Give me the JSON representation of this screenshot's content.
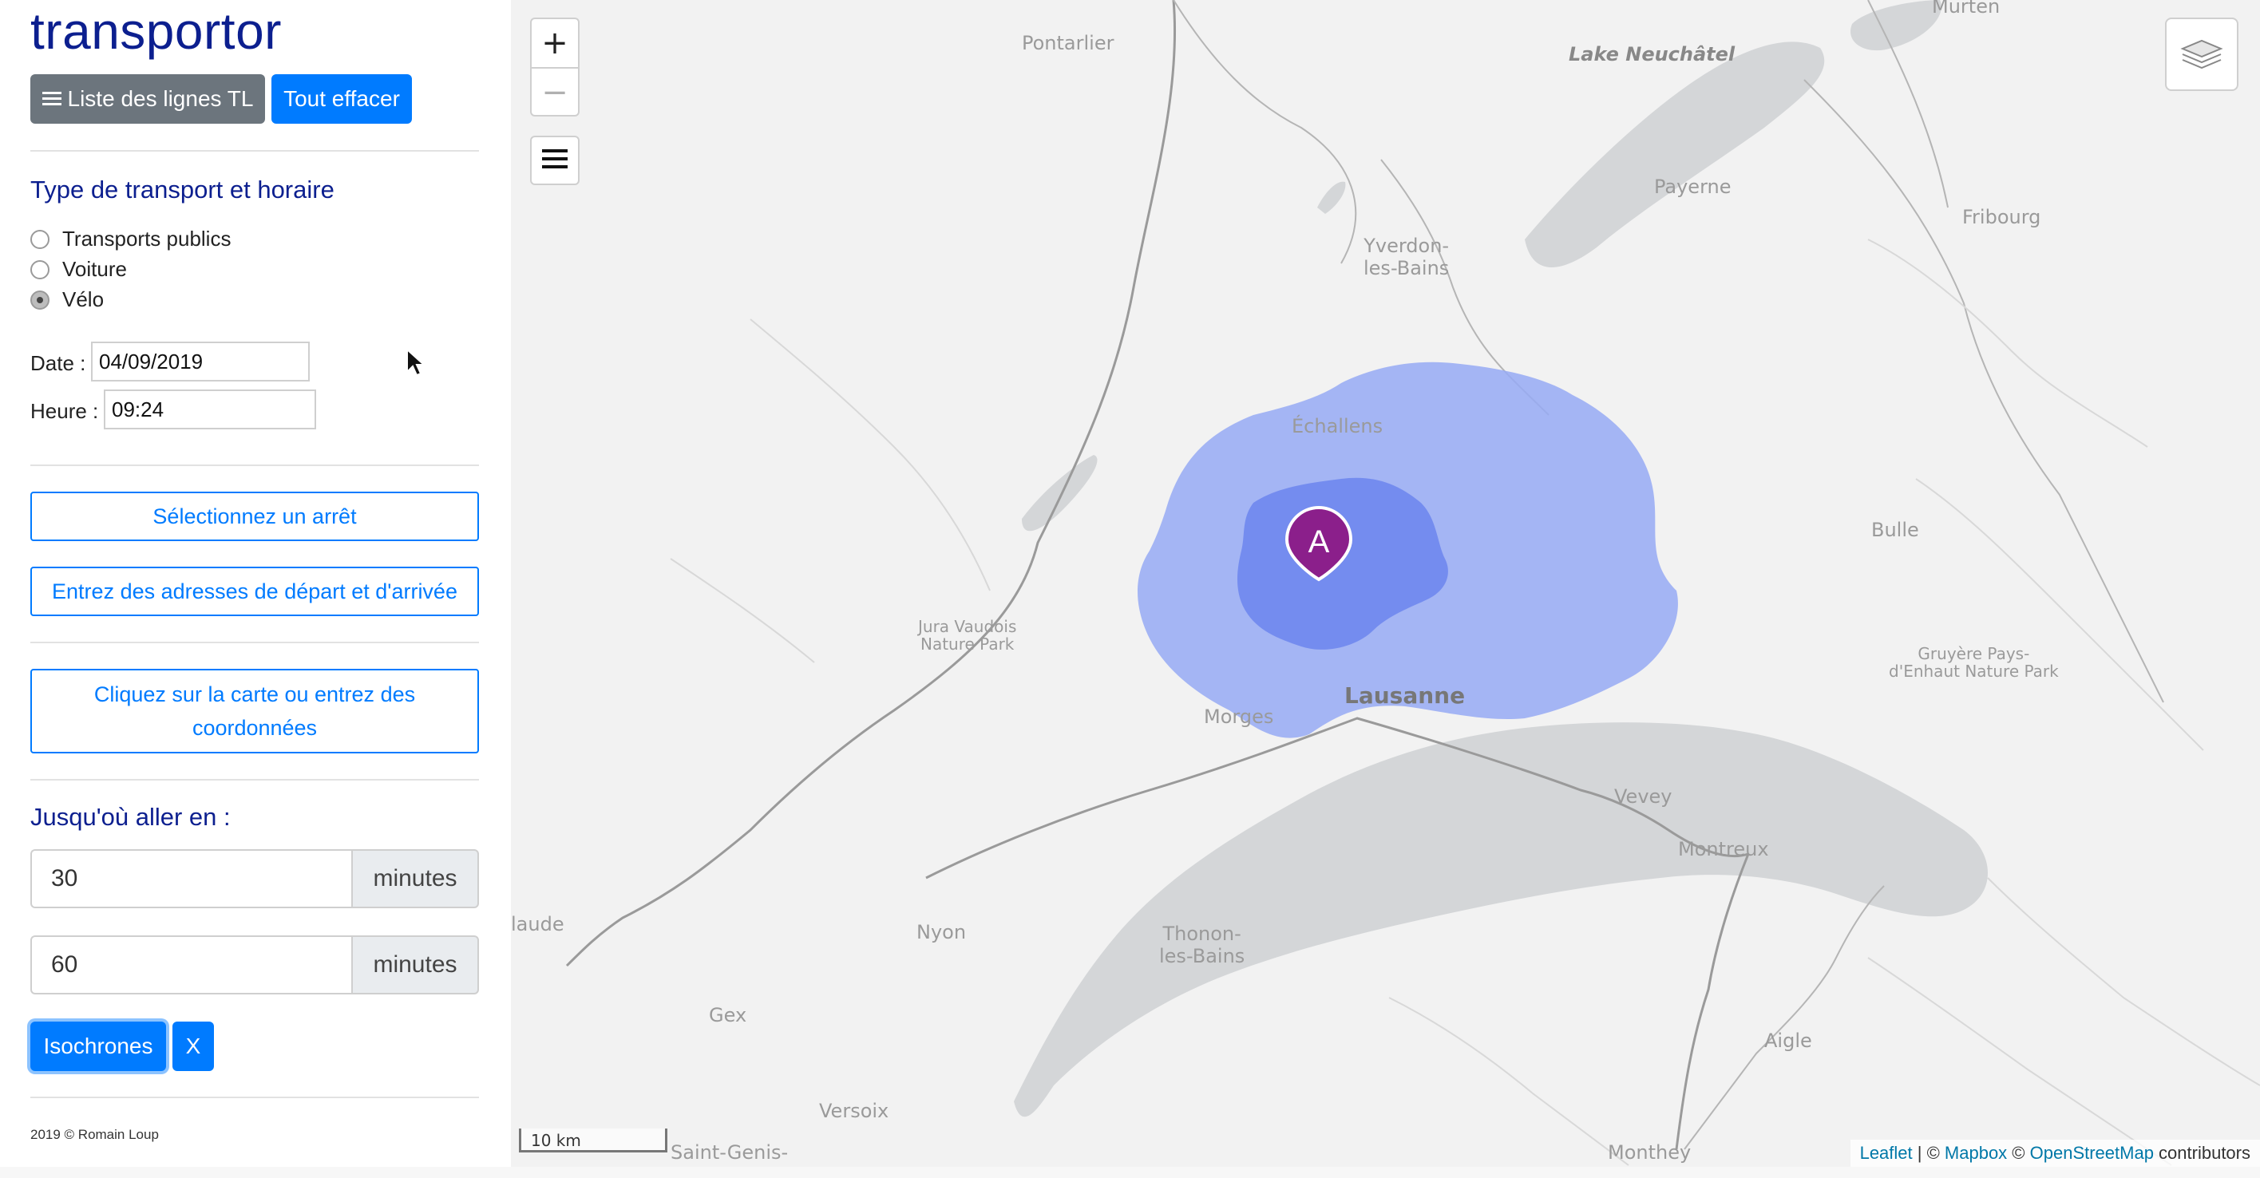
{
  "app": {
    "title": "transportor",
    "lines_button": "Liste des lignes TL",
    "clear_button": "Tout effacer"
  },
  "transport": {
    "section_title": "Type de transport et horaire",
    "options": [
      "Transports publics",
      "Voiture",
      "Vélo"
    ],
    "selected": "Vélo",
    "date_label": "Date :",
    "date_value": "04/09/2019",
    "time_label": "Heure :",
    "time_value": "09:24"
  },
  "actions": {
    "select_stop": "Sélectionnez un arrêt",
    "enter_addresses": "Entrez des adresses de départ et d'arrivée",
    "click_map_line1": "Cliquez sur la carte ou entrez des",
    "click_map_line2": "coordonnées"
  },
  "isochrones": {
    "section_title": "Jusqu'où aller en :",
    "first_value": "30",
    "second_value": "60",
    "unit": "minutes",
    "run_button": "Isochrones",
    "clear_button": "X"
  },
  "footer": "2019 © Romain Loup",
  "map": {
    "zoom_in": "+",
    "zoom_out": "−",
    "marker_letter": "A",
    "scale_label": "10 km",
    "attribution": {
      "leaflet": "Leaflet",
      "sep1": " | © ",
      "mapbox": "Mapbox",
      "sep2": " © ",
      "osm": "OpenStreetMap",
      "suffix": " contributors"
    },
    "labels": {
      "murten": "Murten",
      "pontarlier": "Pontarlier",
      "lake_neuchatel": "Lake Neuchâtel",
      "payerne": "Payerne",
      "fribourg": "Fribourg",
      "yverdon_1": "Yverdon-",
      "yverdon_2": "les-Bains",
      "bulle": "Bulle",
      "jura_1": "Jura Vaudois",
      "jura_2": "Nature Park",
      "gruyere_1": "Gruyère Pays-",
      "gruyere_2": "d'Enhaut Nature Park",
      "echallens": "Échallens",
      "lausanne": "Lausanne",
      "morges": "Morges",
      "vevey": "Vevey",
      "montreux": "Montreux",
      "laude": "laude",
      "nyon": "Nyon",
      "thonon_1": "Thonon-",
      "thonon_2": "les-Bains",
      "gex": "Gex",
      "aigle": "Aigle",
      "versoix": "Versoix",
      "saint_genis": "Saint-Genis-",
      "monthey": "Monthey"
    },
    "colors": {
      "land": "#f2f2f2",
      "water": "#d4d6d8",
      "isochrone_outer": "#96aaf5",
      "isochrone_inner": "#6f87ee",
      "marker": "#8b1f8b"
    }
  }
}
